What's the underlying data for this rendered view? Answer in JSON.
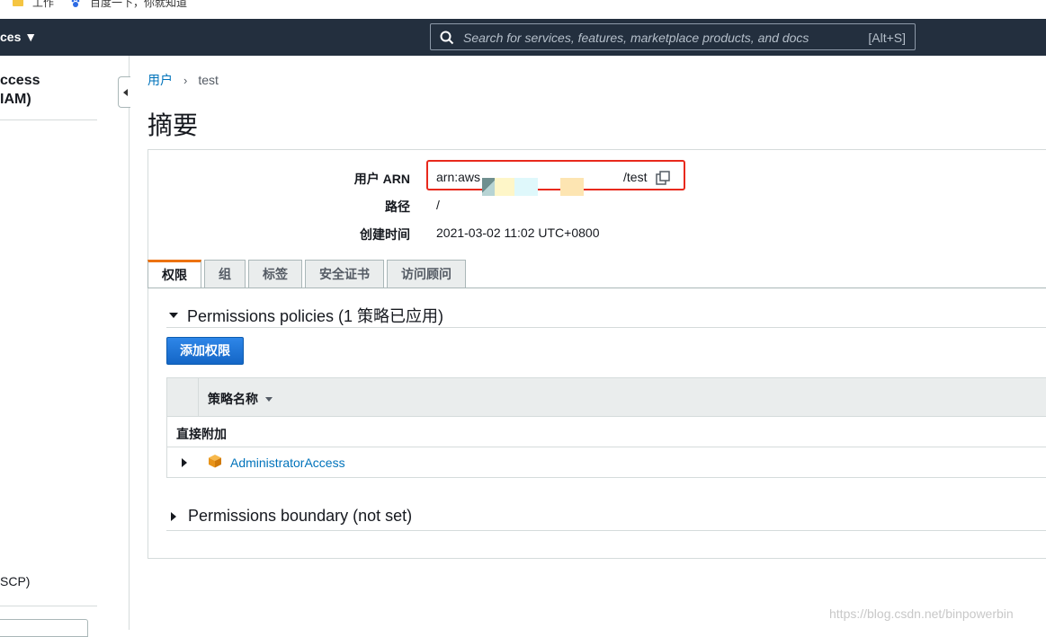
{
  "bookmarks": [
    {
      "label": "工作",
      "icon": "folder-icon"
    },
    {
      "label": "百度一下，你就知道",
      "icon": "baidu-icon"
    }
  ],
  "navbar": {
    "services_label": "ces ▼",
    "search_placeholder": "Search for services, features, marketplace products, and docs",
    "search_shortcut": "[Alt+S]"
  },
  "sidebar": {
    "title_line1": "ccess",
    "title_line2": "IAM)",
    "scp_item": "SCP)"
  },
  "breadcrumb": {
    "parent": "用户",
    "current": "test"
  },
  "page": {
    "title": "摘要"
  },
  "summary": {
    "arn_label": "用户 ARN",
    "arn_value_start": "arn:aws",
    "arn_value_end": "/test",
    "path_label": "路径",
    "path_value": "/",
    "created_label": "创建时间",
    "created_value": "2021-03-02 11:02 UTC+0800"
  },
  "tabs": [
    {
      "label": "权限",
      "active": true
    },
    {
      "label": "组",
      "active": false
    },
    {
      "label": "标签",
      "active": false
    },
    {
      "label": "安全证书",
      "active": false
    },
    {
      "label": "访问顾问",
      "active": false
    }
  ],
  "permissions": {
    "heading": "Permissions policies (1 策略已应用)",
    "add_button": "添加权限",
    "column_policy_name": "策略名称",
    "group_direct": "直接附加",
    "policies": [
      {
        "name": "AdministratorAccess",
        "icon": "aws-managed-policy-icon"
      }
    ],
    "boundary_heading": "Permissions boundary (not set)"
  },
  "watermark": "https://blog.csdn.net/binpowerbin",
  "colors": {
    "navbar_bg": "#232f3e",
    "link": "#0073bb",
    "primary_button": "#1a73d6",
    "active_tab_accent": "#ec7211",
    "highlight_border": "#e8291c"
  }
}
